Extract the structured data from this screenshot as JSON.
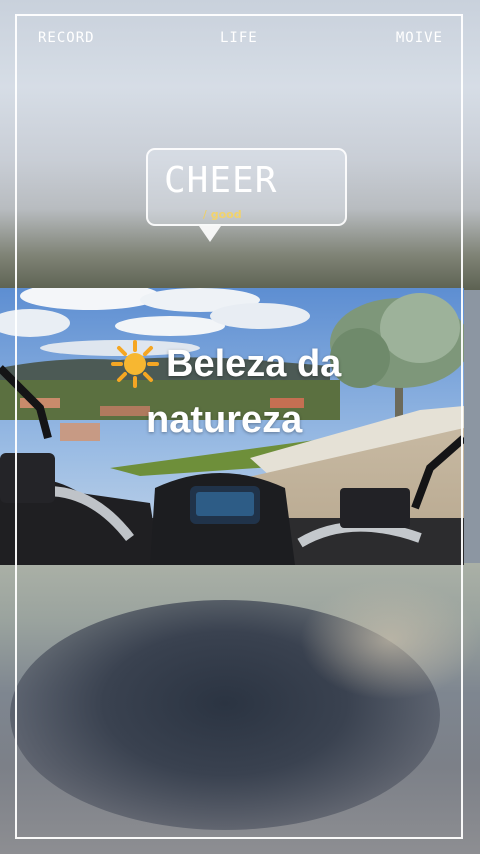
{
  "nav": {
    "record": "RECORD",
    "life": "LIFE",
    "movie": "MOIVE"
  },
  "bubble": {
    "title": "CHEER",
    "slash": "/",
    "subtitle": "good"
  },
  "caption": {
    "line1": "Beleza da",
    "line2": "natureza",
    "emoji": "sun-icon"
  },
  "colors": {
    "frame": "#ffffff",
    "accent": "#f2d36a",
    "sun": "#f5a623"
  }
}
